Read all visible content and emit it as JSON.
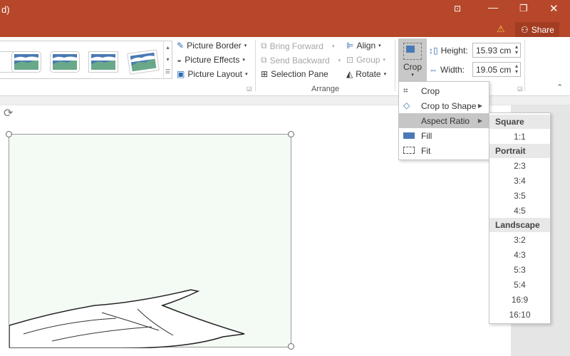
{
  "titlebar": {
    "title_fragment": "d)",
    "share_label": "Share",
    "icons": [
      "ribbon-display-icon",
      "minimize-icon",
      "restore-icon",
      "close-icon",
      "warning-icon",
      "person-icon"
    ]
  },
  "ribbon": {
    "picture_styles": {
      "border": "Picture Border",
      "effects": "Picture Effects",
      "layout": "Picture Layout"
    },
    "arrange": {
      "bring_forward": "Bring Forward",
      "send_backward": "Send Backward",
      "selection_pane": "Selection Pane",
      "align": "Align",
      "group": "Group",
      "rotate": "Rotate",
      "group_label": "Arrange"
    },
    "size": {
      "crop_label": "Crop",
      "height_label": "Height:",
      "height_value": "15.93 cm",
      "width_label": "Width:",
      "width_value": "19.05 cm"
    }
  },
  "crop_menu": {
    "items": [
      {
        "label": "Crop",
        "icon": "crop-icon"
      },
      {
        "label": "Crop to Shape",
        "icon": "crop-shape-icon",
        "submenu": true
      },
      {
        "label": "Aspect Ratio",
        "submenu": true,
        "highlighted": true
      },
      {
        "label": "Fill",
        "icon": "fill-icon"
      },
      {
        "label": "Fit",
        "icon": "fit-icon"
      }
    ]
  },
  "aspect_menu": {
    "square": {
      "header": "Square",
      "items": [
        "1:1"
      ]
    },
    "portrait": {
      "header": "Portrait",
      "items": [
        "2:3",
        "3:4",
        "3:5",
        "4:5"
      ]
    },
    "landscape": {
      "header": "Landscape",
      "items": [
        "3:2",
        "4:3",
        "5:3",
        "5:4",
        "16:9",
        "16:10"
      ]
    }
  },
  "colors": {
    "titlebar": "#b7472a",
    "picture_bg": "#f4faf4",
    "menu_highlight": "#c6c6c6"
  }
}
